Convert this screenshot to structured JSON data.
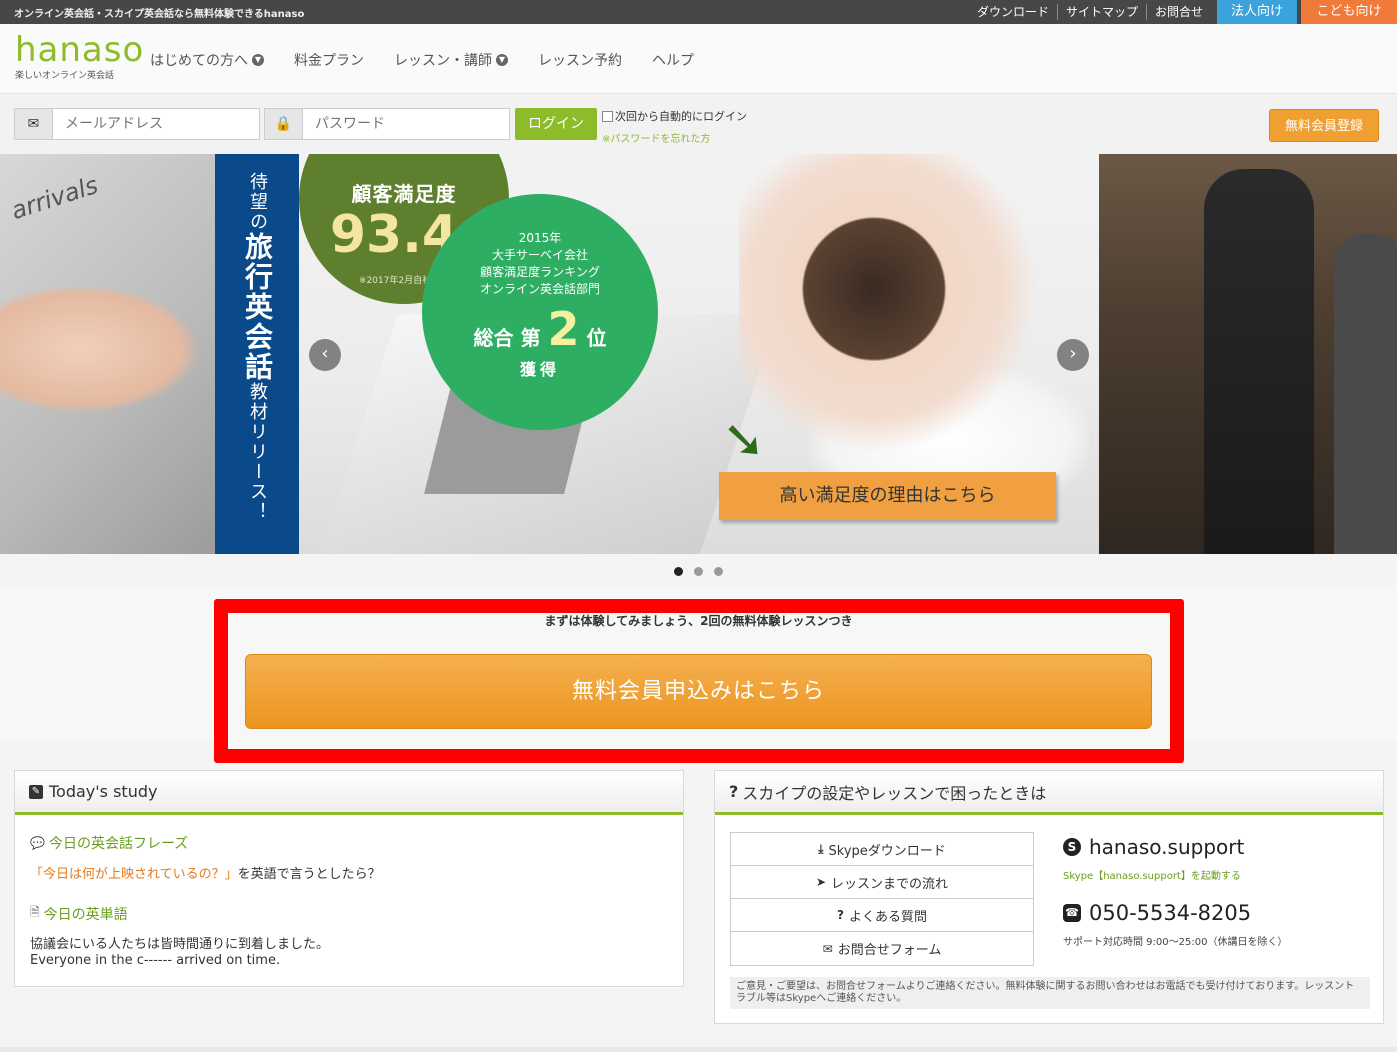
{
  "topbar": {
    "tagline": "オンライン英会話・スカイプ英会話なら無料体験できるhanaso",
    "links": [
      "ダウンロード",
      "サイトマップ",
      "お問合せ"
    ],
    "corporate": "法人向け",
    "kids": "こども向け"
  },
  "header": {
    "logo": "hanaso",
    "logo_sub": "楽しいオンライン英会話",
    "nav": [
      "はじめての方へ",
      "料金プラン",
      "レッスン・講師",
      "レッスン予約",
      "ヘルプ"
    ]
  },
  "login": {
    "email_placeholder": "メールアドレス",
    "password_placeholder": "パスワード",
    "login_label": "ログイン",
    "auto_login": "次回から自動的にログイン",
    "forgot": "※パスワードを忘れた方",
    "register": "無料会員登録"
  },
  "slider": {
    "left_text": "arrivals",
    "vertical_banner_small1": "待望の",
    "vertical_banner_big": "旅行英会話",
    "vertical_banner_small2": "教材リリース！",
    "satisfaction_label": "顧客満足度",
    "satisfaction_value": "93.4",
    "satisfaction_unit": "%",
    "satisfaction_note": "※2017年2月自社調べ",
    "award_year": "2015年",
    "award_line1": "大手サーベイ会社",
    "award_line2": "顧客満足度ランキング",
    "award_line3": "オンライン英会話部門",
    "award_rank_prefix": "総合 第",
    "award_rank": "2",
    "award_rank_suffix": "位",
    "award_get": "獲得",
    "arrow": "➘",
    "cta": "高い満足度の理由はこちら",
    "prev": "‹",
    "next": "›"
  },
  "signup": {
    "lead": "まずは体験してみましょう、2回の無料体験レッスンつき",
    "button": "無料会員申込みはこちら"
  },
  "study": {
    "title": "Today's study",
    "phrase_title": "今日の英会話フレーズ",
    "phrase_highlight": "「今日は何が上映されているの？」",
    "phrase_rest": "を英語で言うとしたら？",
    "word_title": "今日の英単語",
    "word_jp": "協議会にいる人たちは皆時間通りに到着しました。",
    "word_en": "Everyone in the c------ arrived on time."
  },
  "help": {
    "title": "スカイプの設定やレッスンで困ったときは",
    "links": [
      "Skypeダウンロード",
      "レッスンまでの流れ",
      "よくある質問",
      "お問合せフォーム"
    ],
    "skype_id": "hanaso.support",
    "skype_start": "Skype【hanaso.support】を起動する",
    "phone": "050-5534-8205",
    "hours": "サポート対応時間 9:00～25:00（休講日を除く）",
    "note": "ご意見・ご要望は、お問合せフォームよりご連絡ください。無料体験に関するお問い合わせはお電話でも受け付けております。レッスントラブル等はSkypeへご連絡ください。"
  },
  "colors": {
    "brand_green": "#8dbb2a",
    "orange": "#f0a030",
    "highlight_red": "#ff0000"
  }
}
